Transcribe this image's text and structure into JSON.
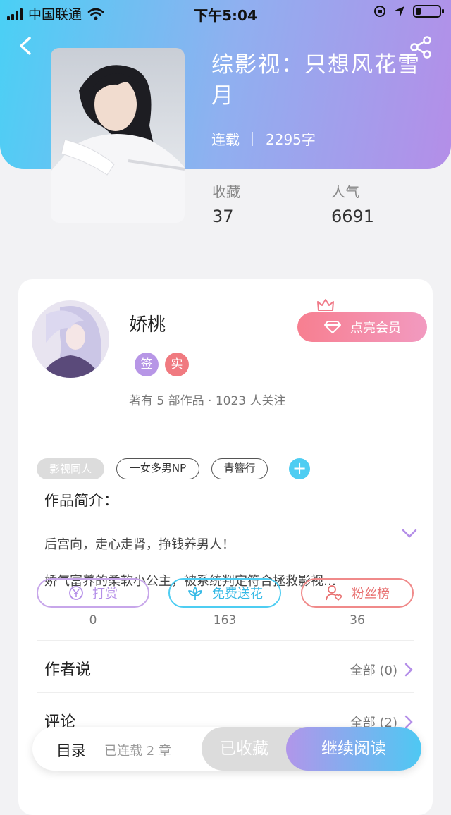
{
  "status_bar": {
    "carrier": "中国联通",
    "time": "下午5:04",
    "battery_level": 0.22
  },
  "book": {
    "title": "综影视：只想风花雪月",
    "status": "连载",
    "word_count": "2295字"
  },
  "stats": {
    "favorites_label": "收藏",
    "favorites_value": "37",
    "popularity_label": "人气",
    "popularity_value": "6691"
  },
  "author": {
    "name": "娇桃",
    "badges": [
      "签",
      "实"
    ],
    "info": "著有 5 部作品 · 1023 人关注",
    "vip_button": "点亮会员"
  },
  "tags": [
    "影视同人",
    "一女多男NP",
    "青簪行"
  ],
  "intro": {
    "title": "作品简介：",
    "line1": "后宫向，走心走肾，挣钱养男人！",
    "line2": "娇气富养的柔软小公主，被系统判定符合拯救影视…"
  },
  "actions": [
    {
      "label": "打赏",
      "count": "0",
      "color": "#c7a6ea"
    },
    {
      "label": "免费送花",
      "count": "163",
      "color": "#4ecdf2"
    },
    {
      "label": "粉丝榜",
      "count": "36",
      "color": "#f08a8a"
    }
  ],
  "rows": [
    {
      "title": "作者说",
      "right": "全部 (0)"
    },
    {
      "title": "评论",
      "right": "全部 (2)"
    }
  ],
  "bottom_bar": {
    "toc": "目录",
    "chapters": "已连载 2 章",
    "favorited": "已收藏",
    "continue": "继续阅读"
  },
  "colors": {
    "accent_cyan": "#4ecdf2",
    "accent_purple": "#b48ee8",
    "vip_pink": "#f77f90"
  }
}
